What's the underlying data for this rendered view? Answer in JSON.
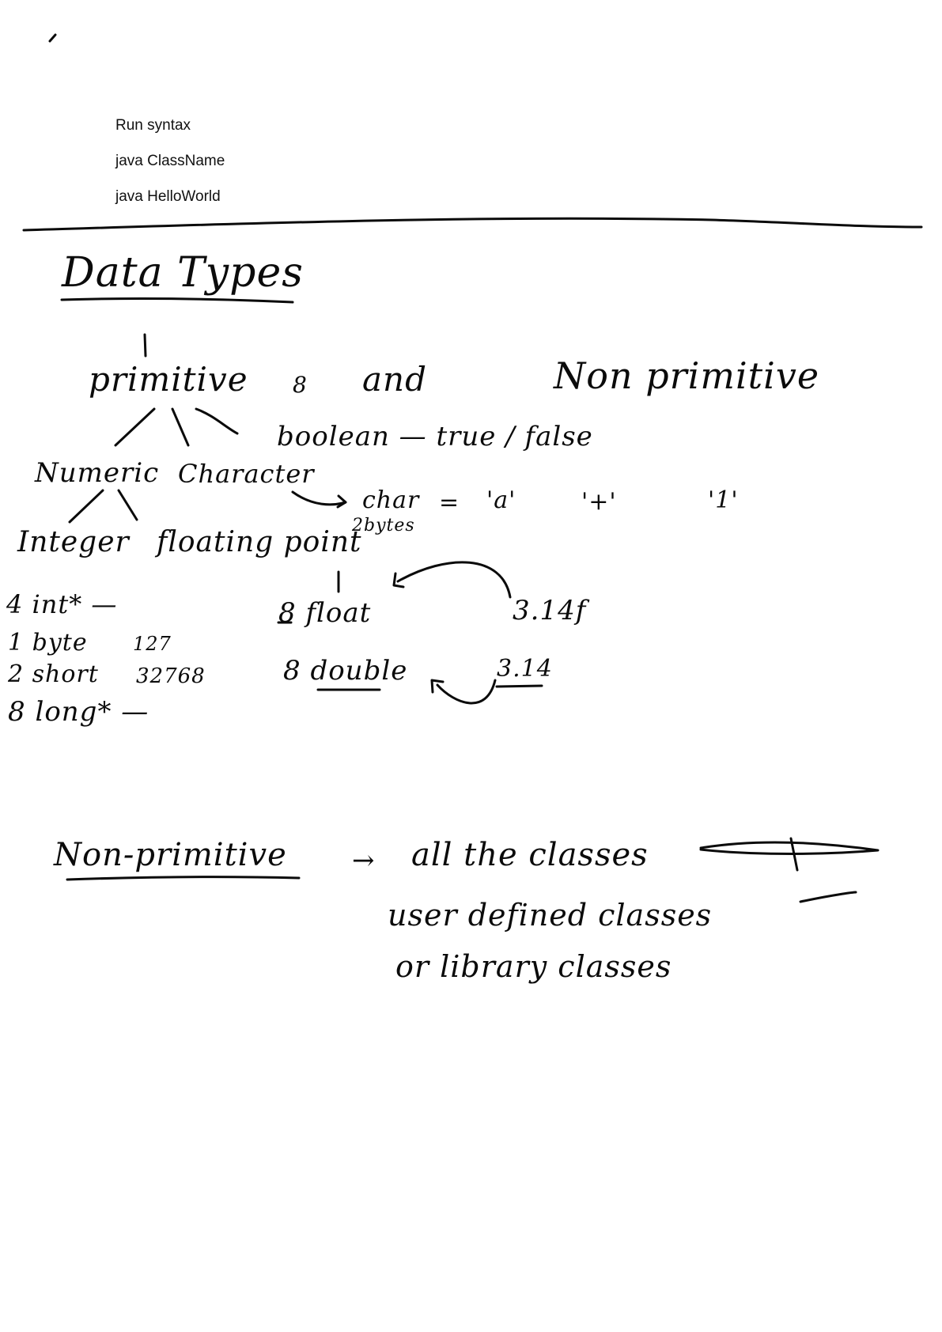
{
  "typed_notes": {
    "line1": "Run syntax",
    "line2": "java ClassName",
    "line3": "java HelloWorld"
  },
  "handwritten": {
    "title": "Data Types",
    "primitive": "primitive",
    "count": "8",
    "and": "and",
    "non_primitive_heading": "Non primitive",
    "boolean_line": "boolean — true / false",
    "numeric": "Numeric",
    "character": "Character",
    "char_line": "char",
    "char_eq": "=",
    "char_ex1": "'a'",
    "char_ex2": "'+'",
    "char_ex3": "'1'",
    "char_size": "2bytes",
    "integer": "Integer",
    "floating_point": "floating point",
    "int_row": "4 int* —",
    "byte_row": "1 byte",
    "byte_val": "127",
    "short_row": "2 short",
    "short_val": "32768",
    "long_row": "8 long* —",
    "float_row": "8 float",
    "float_ex": "3.14f",
    "double_row": "8 double",
    "double_ex": "3.14",
    "np_label": "Non-primitive",
    "np_arrow": "→",
    "np_line1": "all the classes",
    "np_line2": "user defined classes",
    "np_line3": "or library classes"
  }
}
